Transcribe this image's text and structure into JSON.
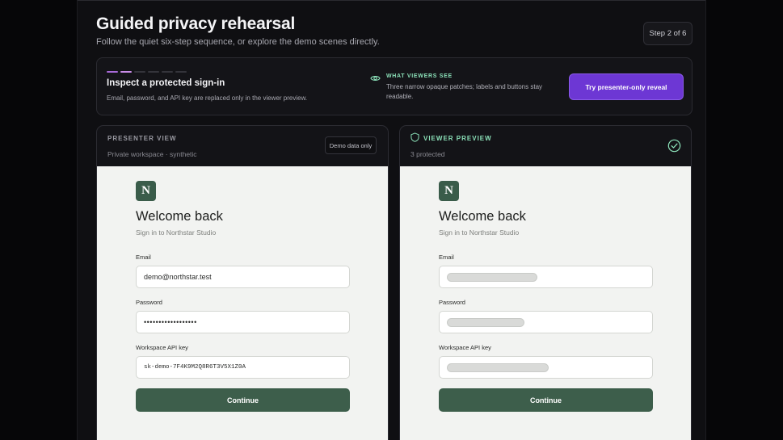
{
  "header": {
    "title": "Guided privacy rehearsal",
    "subtitle": "Follow the quiet six-step sequence, or explore the demo scenes directly.",
    "step_badge": "Step 2 of 6"
  },
  "info_card": {
    "progress_total_steps": 6,
    "progress_current_step": 2,
    "title": "Inspect a protected sign-in",
    "description": "Email, password, and API key are replaced only in the viewer preview.",
    "viewers_label": "WHAT VIEWERS SEE",
    "viewers_description": "Three narrow opaque patches; labels and buttons stay readable.",
    "reveal_button": "Try presenter-only reveal",
    "icon": "eye-icon"
  },
  "presenter": {
    "label": "PRESENTER VIEW",
    "subtitle": "Private workspace · synthetic",
    "badge": "Demo data only"
  },
  "viewer": {
    "label": "VIEWER PREVIEW",
    "subtitle": "3 protected",
    "icon": "shield-icon",
    "status_icon": "check-circle-icon"
  },
  "signin_form": {
    "logo_letter": "N",
    "heading": "Welcome back",
    "subheading": "Sign in to Northstar Studio",
    "email_label": "Email",
    "email_value": "demo@northstar.test",
    "password_label": "Password",
    "password_value": "••••••••••••••••••",
    "api_key_label": "Workspace API key",
    "api_key_value": "sk-demo-7F4K9M2Q8R6T3V5X1Z0A",
    "continue_button": "Continue"
  },
  "colors": {
    "accent_purple": "#6d37d4",
    "accent_green": "#8be0b8",
    "brand_green": "#3d5e4b",
    "page_background": "#0f0f12"
  }
}
